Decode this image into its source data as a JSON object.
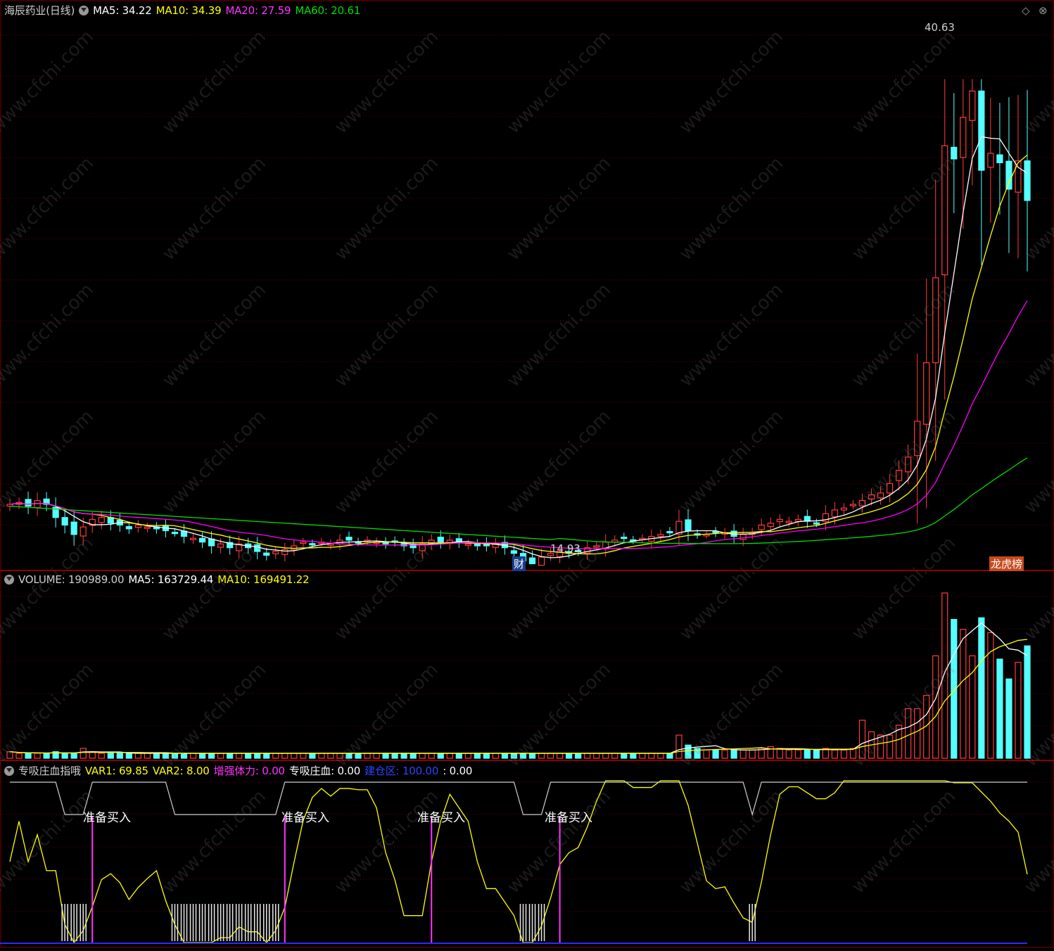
{
  "panel1": {
    "title": "海辰药业(日线)",
    "ma5": "MA5: 34.22",
    "ma10": "MA10: 34.39",
    "ma20": "MA20: 27.59",
    "ma60": "MA60: 20.61",
    "high_label": "40.63",
    "low_label": "14.93",
    "badge_cai": "财",
    "badge_bang": "龙虎榜"
  },
  "panel2": {
    "volume": "VOLUME: 190989.00",
    "ma5": "MA5: 163729.44",
    "ma10": "MA10: 169491.22"
  },
  "panel3": {
    "name": "专吸庄血指哦",
    "var1": "VAR1: 69.85",
    "var2": "VAR2: 8.00",
    "zqtl": "增强体力: 0.00",
    "zxzx": "专吸庄血: 0.00",
    "jcq": "建仓区: 100.00",
    "last": ": 0.00",
    "signal": "准备买入"
  },
  "watermark": "www.cfchi.com",
  "colors": {
    "up": "#ff3b3b",
    "down": "#54ffff",
    "ma5": "#ffffff",
    "ma10": "#ffff00",
    "ma20": "#ff00ff",
    "ma60": "#00dd00",
    "grid": "#6b0000"
  },
  "chart_data": [
    {
      "type": "candlestick",
      "title": "海辰药业(日线)",
      "price_high": 40.63,
      "price_low": 14.93,
      "close": [
        18.1,
        18.2,
        18.0,
        18.3,
        18.1,
        17.4,
        17.0,
        16.5,
        16.9,
        17.3,
        17.4,
        17.1,
        17.0,
        16.8,
        17.0,
        16.9,
        16.8,
        16.7,
        16.6,
        16.4,
        16.3,
        16.1,
        15.9,
        16.0,
        15.8,
        16.0,
        15.8,
        15.6,
        15.4,
        15.6,
        15.7,
        15.9,
        16.1,
        16.0,
        16.1,
        16.0,
        16.2,
        16.2,
        16.1,
        16.2,
        16.1,
        16.0,
        16.1,
        15.9,
        15.8,
        16.0,
        16.2,
        16.1,
        16.2,
        16.1,
        16.0,
        15.9,
        15.9,
        16.0,
        15.8,
        15.5,
        15.1,
        14.95,
        15.3,
        15.5,
        15.6,
        15.5,
        15.6,
        15.8,
        15.9,
        16.1,
        16.2,
        16.3,
        16.2,
        16.3,
        16.4,
        16.5,
        16.6,
        17.2,
        16.7,
        16.5,
        16.5,
        16.6,
        16.6,
        16.4,
        16.5,
        16.6,
        17.0,
        17.1,
        17.3,
        17.2,
        17.3,
        17.2,
        17.1,
        17.6,
        17.8,
        17.9,
        18.1,
        18.3,
        18.6,
        18.7,
        19.2,
        19.9,
        20.6,
        22.5,
        25.6,
        30.1,
        37.1,
        36.4,
        38.6,
        40.0,
        35.8,
        36.7,
        36.2,
        34.8,
        36.3,
        34.2
      ],
      "volume_last": 190989,
      "ma_legend": {
        "MA5": 34.22,
        "MA10": 34.39,
        "MA20": 27.59,
        "MA60": 20.61
      }
    },
    {
      "type": "bar",
      "title": "VOLUME",
      "values_rel": [
        0.04,
        0.03,
        0.03,
        0.03,
        0.03,
        0.04,
        0.03,
        0.03,
        0.06,
        0.04,
        0.03,
        0.03,
        0.03,
        0.03,
        0.03,
        0.03,
        0.03,
        0.03,
        0.03,
        0.03,
        0.03,
        0.03,
        0.03,
        0.03,
        0.03,
        0.03,
        0.03,
        0.03,
        0.03,
        0.03,
        0.03,
        0.03,
        0.03,
        0.03,
        0.03,
        0.03,
        0.03,
        0.03,
        0.03,
        0.03,
        0.03,
        0.03,
        0.03,
        0.03,
        0.03,
        0.03,
        0.03,
        0.03,
        0.03,
        0.03,
        0.03,
        0.03,
        0.03,
        0.03,
        0.03,
        0.03,
        0.03,
        0.03,
        0.03,
        0.03,
        0.03,
        0.03,
        0.03,
        0.03,
        0.03,
        0.03,
        0.03,
        0.03,
        0.03,
        0.03,
        0.03,
        0.03,
        0.03,
        0.14,
        0.08,
        0.06,
        0.05,
        0.05,
        0.05,
        0.05,
        0.05,
        0.05,
        0.06,
        0.07,
        0.06,
        0.05,
        0.05,
        0.05,
        0.05,
        0.06,
        0.05,
        0.05,
        0.06,
        0.23,
        0.16,
        0.14,
        0.14,
        0.2,
        0.3,
        0.3,
        0.38,
        0.62,
        1.0,
        0.84,
        0.78,
        0.62,
        0.85,
        0.76,
        0.6,
        0.48,
        0.58,
        0.68
      ],
      "series": [
        {
          "name": "MA5",
          "last": 163729.44
        },
        {
          "name": "MA10",
          "last": 169491.22
        }
      ]
    },
    {
      "type": "line",
      "title": "专吸庄血指哦",
      "ylim": [
        0,
        100
      ],
      "series": [
        {
          "name": "VAR1",
          "last": 69.85
        }
      ],
      "signals_index": [
        9,
        30,
        46,
        60
      ]
    }
  ]
}
